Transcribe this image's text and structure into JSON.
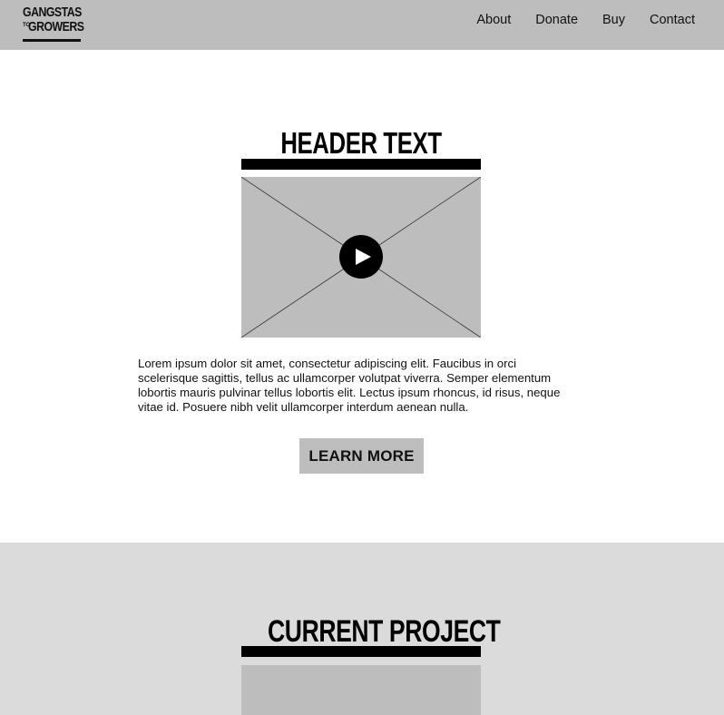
{
  "logo": {
    "line1": "GANGSTAS",
    "small": "TO",
    "line2": "GROWERS"
  },
  "nav": {
    "items": [
      "About",
      "Donate",
      "Buy",
      "Contact"
    ]
  },
  "hero": {
    "title": "HEADER TEXT",
    "body": "Lorem ipsum dolor sit amet, consectetur adipiscing elit. Faucibus in orci scelerisque sagittis, tellus ac ullamcorper volutpat viverra. Semper elementum lobortis mauris pulvinar tellus lobortis elit. Lectus ipsum rhoncus, id risus, neque vitae id. Posuere nibh velit ullamcorper interdum aenean nulla.",
    "cta": "LEARN MORE"
  },
  "project": {
    "title": "CURRENT PROJECT"
  },
  "colors": {
    "header_bg": "#bdbdbd",
    "placeholder": "#bdbdbd",
    "section_bg": "#dbdbdb",
    "accent": "#000000"
  },
  "icons": {
    "play": "play-icon"
  }
}
